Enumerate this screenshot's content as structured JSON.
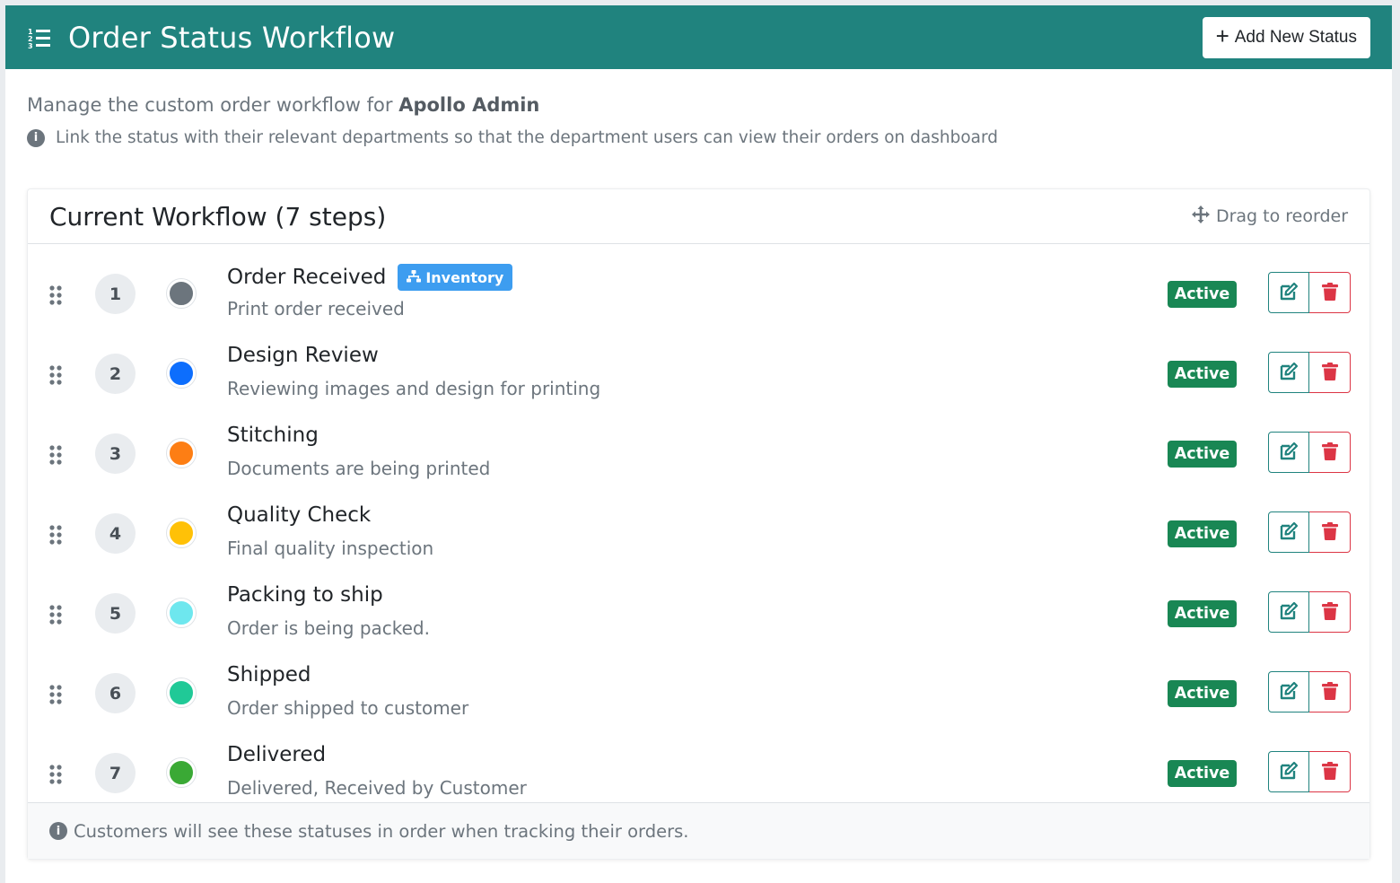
{
  "header": {
    "title": "Order Status Workflow",
    "add_button_label": "Add New Status",
    "icons": {
      "title": "list-ol-icon",
      "add": "plus-icon"
    }
  },
  "intro": {
    "manage_prefix": "Manage the custom order workflow for",
    "company": "Apollo Admin",
    "hint": "Link the status with their relevant departments so that the department users can view their orders on dashboard"
  },
  "workflow": {
    "title": "Current Workflow (7 steps)",
    "drag_hint": "Drag to reorder",
    "footer_note": "Customers will see these statuses in order when tracking their orders.",
    "statuses": [
      {
        "step": "1",
        "name": "Order Received",
        "description": "Print order received",
        "color": "#6c757d",
        "department": "Inventory",
        "state": "Active"
      },
      {
        "step": "2",
        "name": "Design Review",
        "description": "Reviewing images and design for printing",
        "color": "#0d6efd",
        "department": "",
        "state": "Active"
      },
      {
        "step": "3",
        "name": "Stitching",
        "description": "Documents are being printed",
        "color": "#fd7e14",
        "department": "",
        "state": "Active"
      },
      {
        "step": "4",
        "name": "Quality Check",
        "description": "Final quality inspection",
        "color": "#ffc107",
        "department": "",
        "state": "Active"
      },
      {
        "step": "5",
        "name": "Packing to ship",
        "description": "Order is being packed.",
        "color": "#6ee7ee",
        "department": "",
        "state": "Active"
      },
      {
        "step": "6",
        "name": "Shipped",
        "description": "Order shipped to customer",
        "color": "#20c997",
        "department": "",
        "state": "Active"
      },
      {
        "step": "7",
        "name": "Delivered",
        "description": "Delivered, Received by Customer",
        "color": "#3aa935",
        "department": "",
        "state": "Active"
      }
    ]
  },
  "colors": {
    "header_bg": "#20837e",
    "active_badge": "#198754",
    "department_badge": "#3d9df0",
    "delete": "#dc3545"
  }
}
